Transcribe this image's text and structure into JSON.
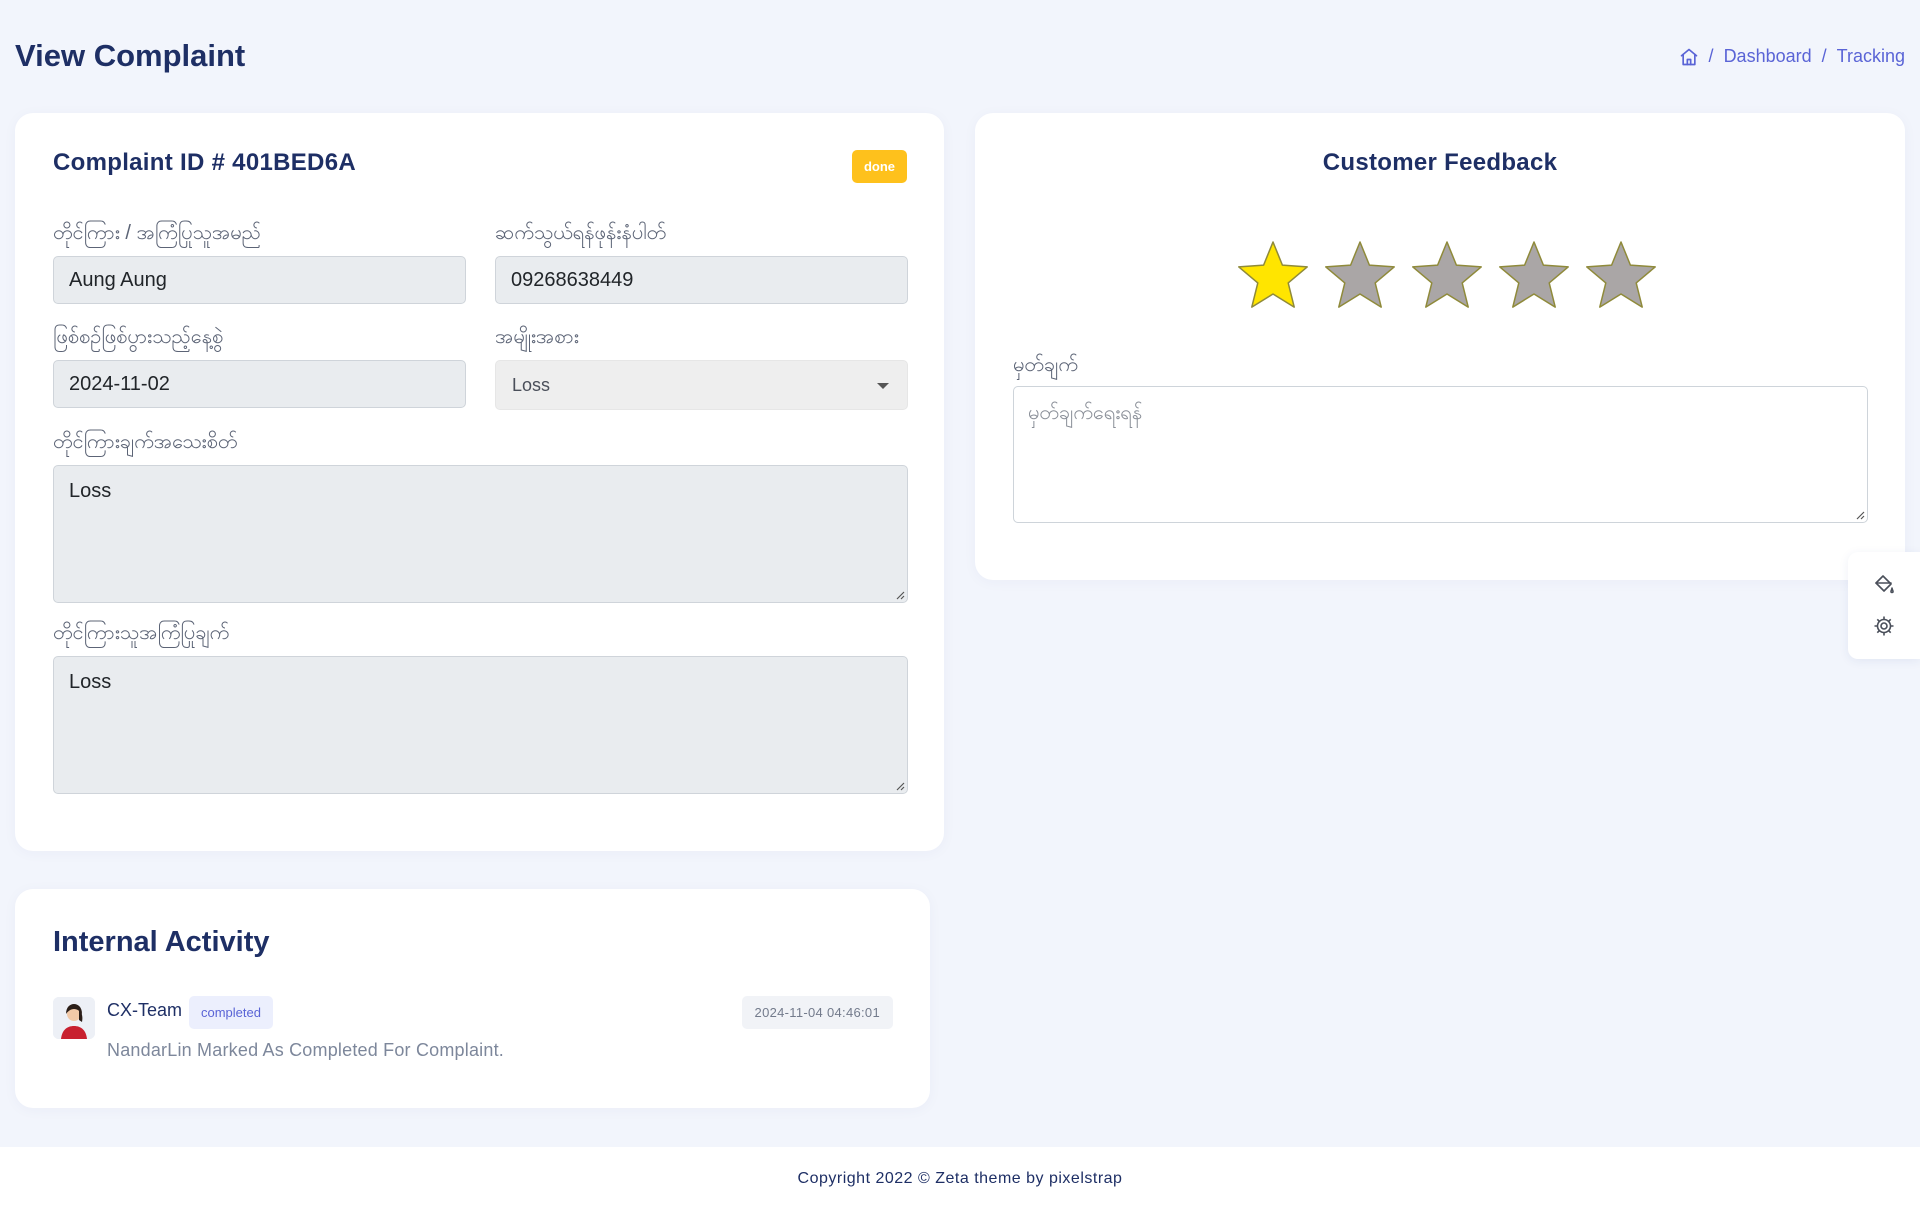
{
  "header": {
    "page_title": "View Complaint",
    "breadcrumb": {
      "home_icon": "home-icon",
      "separator": "/",
      "items": [
        "Dashboard",
        "Tracking"
      ]
    }
  },
  "complaint": {
    "title": "Complaint ID # 401BED6A",
    "status": "done",
    "status_color": "#fec11c",
    "fields": {
      "complainant_name": {
        "label": "တိုင်ကြား / အကြံပြုသူအမည်",
        "value": "Aung Aung"
      },
      "phone": {
        "label": "ဆက်သွယ်ရန်ဖုန်းနံပါတ်",
        "value": "09268638449"
      },
      "date": {
        "label": "ဖြစ်စဉ်ဖြစ်ပွားသည့်နေ့စွဲ",
        "value": "2024-11-02"
      },
      "type": {
        "label": "အမျိုးအစား",
        "selected": "Loss"
      },
      "details": {
        "label": "တိုင်ကြားချက်အသေးစိတ်",
        "value": "Loss"
      },
      "suggestion": {
        "label": "တိုင်ကြားသူအကြံပြုချက်",
        "value": "Loss"
      }
    }
  },
  "feedback": {
    "title": "Customer Feedback",
    "rating": 1,
    "max_rating": 5,
    "star_active_color": "#ffe500",
    "star_inactive_color": "#aaa6a6",
    "remark_label": "မှတ်ချက်",
    "remark_placeholder": "မှတ်ချက်ရေးရန်"
  },
  "float_tools": {
    "paint_icon": "paint-bucket-icon",
    "settings_icon": "gear-icon"
  },
  "activity": {
    "title": "Internal Activity",
    "items": [
      {
        "user": "CX-Team",
        "badge": "completed",
        "timestamp": "2024-11-04 04:46:01",
        "text": "NandarLin Marked As Completed For Complaint."
      }
    ]
  },
  "footer": {
    "text": "Copyright 2022 © Zeta theme by pixelstrap"
  }
}
